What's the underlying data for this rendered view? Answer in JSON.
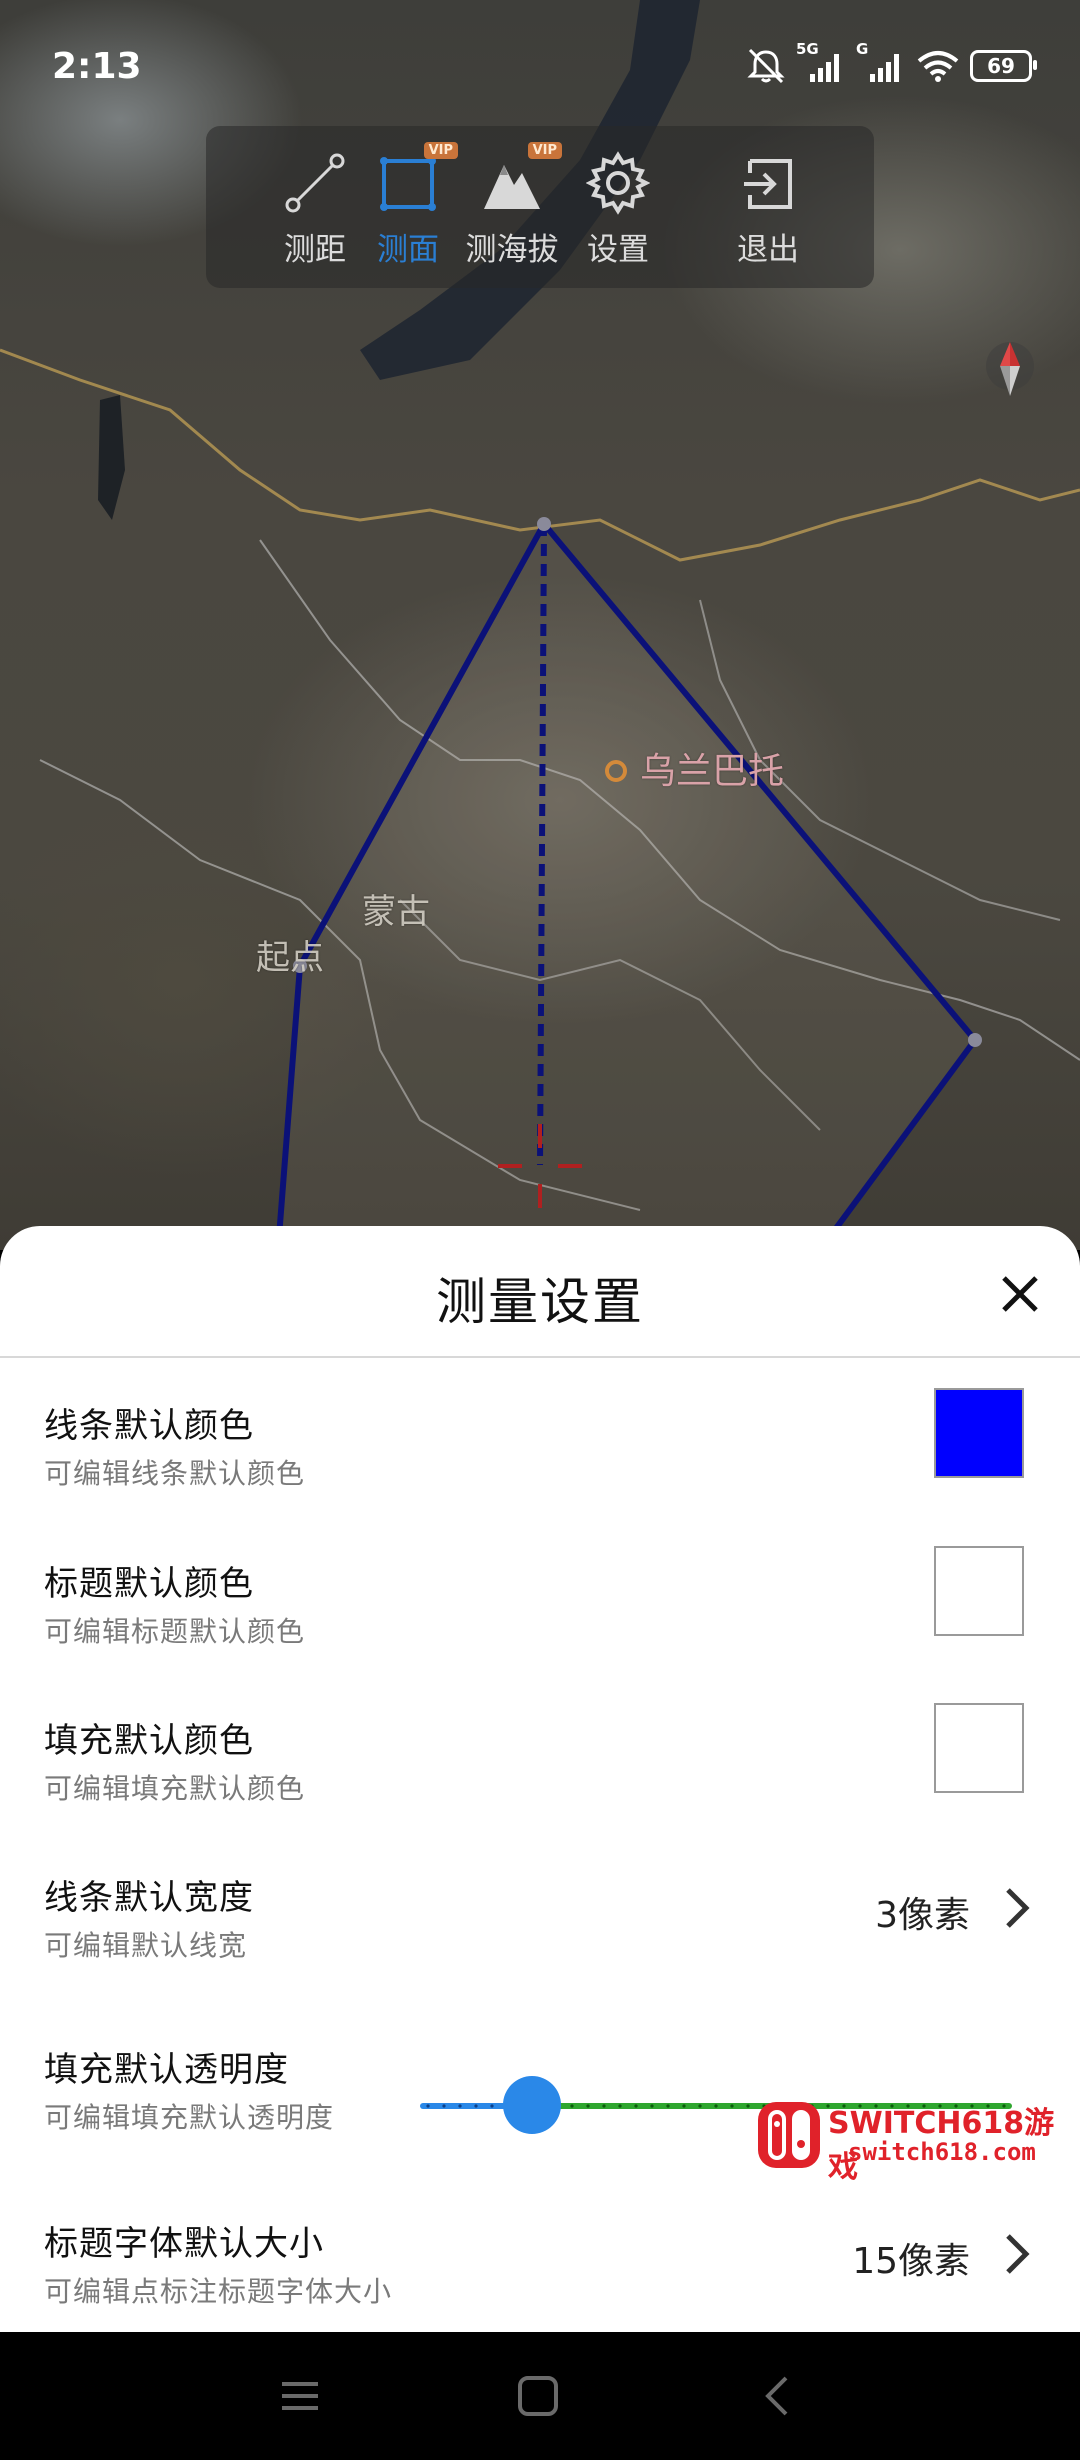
{
  "status_bar": {
    "time": "2:13",
    "network_1": "5G",
    "network_2": "G",
    "battery": "69",
    "icons": [
      "bell-off-icon",
      "signal-icon",
      "signal-icon",
      "wifi-icon",
      "battery-icon"
    ]
  },
  "toolbar": {
    "items": [
      {
        "label": "测距",
        "icon": "ruler-line-icon",
        "vip": false,
        "active": false
      },
      {
        "label": "测面",
        "icon": "area-square-icon",
        "vip": true,
        "active": true
      },
      {
        "label": "测海拔",
        "icon": "mountain-icon",
        "vip": true,
        "active": false
      },
      {
        "label": "设置",
        "icon": "gear-icon",
        "vip": false,
        "active": false
      },
      {
        "label": "退出",
        "icon": "exit-icon",
        "vip": false,
        "active": false
      }
    ],
    "vip_badge": "VIP",
    "active_color": "#2a7fd4"
  },
  "map": {
    "labels": {
      "start": "起点",
      "mongolia": "蒙古",
      "ulaanbaatar": "乌兰巴托"
    },
    "line_color": "#0b1178",
    "crosshair_color": "#b02020"
  },
  "sheet": {
    "title": "测量设置",
    "close_icon": "close-icon",
    "rows": [
      {
        "title": "线条默认颜色",
        "subtitle": "可编辑线条默认颜色",
        "swatch_color": "#0000ff"
      },
      {
        "title": "标题默认颜色",
        "subtitle": "可编辑标题默认颜色",
        "swatch_color": "#ffffff"
      },
      {
        "title": "填充默认颜色",
        "subtitle": "可编辑填充默认颜色",
        "swatch_color": "#ffffff"
      },
      {
        "title": "线条默认宽度",
        "subtitle": "可编辑默认线宽",
        "value": "3像素"
      },
      {
        "title": "填充默认透明度",
        "subtitle": "可编辑填充默认透明度",
        "slider_fraction": 0.19
      },
      {
        "title": "标题字体默认大小",
        "subtitle": "可编辑点标注标题字体大小",
        "value": "15像素"
      }
    ]
  },
  "watermark": {
    "line1": "SWITCH618游戏",
    "line2": "switch618.com"
  },
  "nav_bar": {
    "buttons": [
      "menu-icon",
      "home-icon",
      "back-icon"
    ]
  }
}
